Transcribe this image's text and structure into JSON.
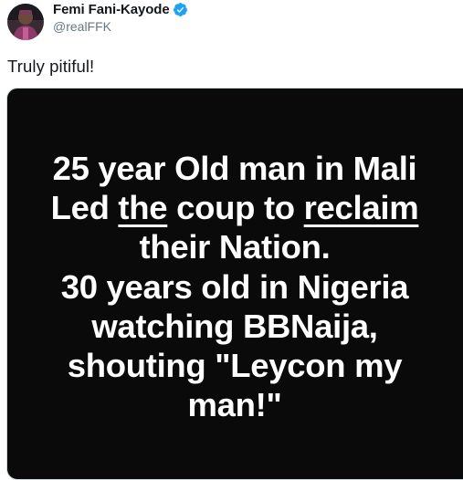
{
  "tweet": {
    "author": {
      "display_name": "Femi Fani-Kayode",
      "handle": "@realFFK",
      "verified": true,
      "avatar_icon": "profile-photo",
      "verified_icon": "verified-badge-icon",
      "verified_color": "#1da1f2"
    },
    "text": "Truly pitiful!",
    "media": {
      "background_color": "#0a0a0a",
      "text_color": "#ffffff",
      "lines": [
        {
          "parts": [
            "25 year Old man in Mali"
          ]
        },
        {
          "parts": [
            "Led ",
            "the",
            " coup to ",
            "reclaim"
          ]
        },
        {
          "parts": [
            "their Nation."
          ]
        },
        {
          "parts": [
            "30 years old in Nigeria"
          ]
        },
        {
          "parts": [
            "watching BBNaija,"
          ]
        },
        {
          "parts": [
            "shouting \"Leycon my"
          ]
        },
        {
          "parts": [
            "man!\""
          ]
        }
      ]
    }
  }
}
